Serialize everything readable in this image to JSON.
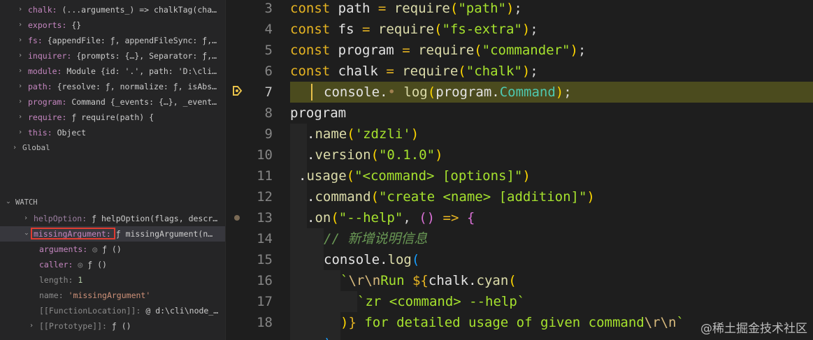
{
  "variables": [
    {
      "name": "chalk:",
      "value": "(...arguments_) => chalkTag(cha…"
    },
    {
      "name": "exports:",
      "value": "{}"
    },
    {
      "name": "fs:",
      "value": "{appendFile: ƒ, appendFileSync: ƒ,…"
    },
    {
      "name": "inquirer:",
      "value": "{prompts: {…}, Separator: ƒ,…"
    },
    {
      "name": "module:",
      "value": "Module {id: '.', path: 'D:\\cli…"
    },
    {
      "name": "path:",
      "value": "{resolve: ƒ, normalize: ƒ, isAbs…"
    },
    {
      "name": "program:",
      "value": "Command {_events: {…}, _event…"
    },
    {
      "name": "require:",
      "value": "ƒ require(path) {"
    },
    {
      "name": "this:",
      "value": "Object"
    }
  ],
  "global_label": "Global",
  "watch": {
    "header": "WATCH",
    "help_option": {
      "name": "helpOption:",
      "value": "ƒ helpOption(flags, descr…"
    },
    "missing_argument": {
      "name": "missingArgument:",
      "value": "ƒ missingArgument(n…"
    },
    "children": [
      {
        "name": "arguments:",
        "value": "ƒ ()"
      },
      {
        "name": "caller:",
        "value": "ƒ ()"
      },
      {
        "name": "length:",
        "value": "1"
      },
      {
        "name": "name:",
        "value": "'missingArgument'"
      },
      {
        "name": "[[FunctionLocation]]:",
        "value": "@ d:\\cli\\node_…"
      },
      {
        "name": "[[Prototype]]:",
        "value": "ƒ ()"
      }
    ]
  },
  "line_numbers": [
    "3",
    "4",
    "5",
    "6",
    "7",
    "8",
    "9",
    "10",
    "11",
    "12",
    "13",
    "14",
    "15",
    "16",
    "17",
    "18"
  ],
  "watermark": "@稀土掘金技术社区",
  "colors": {
    "current_line": "#4b4b1e",
    "breakpoint": "#6b1f27",
    "highlight_box": "#e03c31"
  }
}
